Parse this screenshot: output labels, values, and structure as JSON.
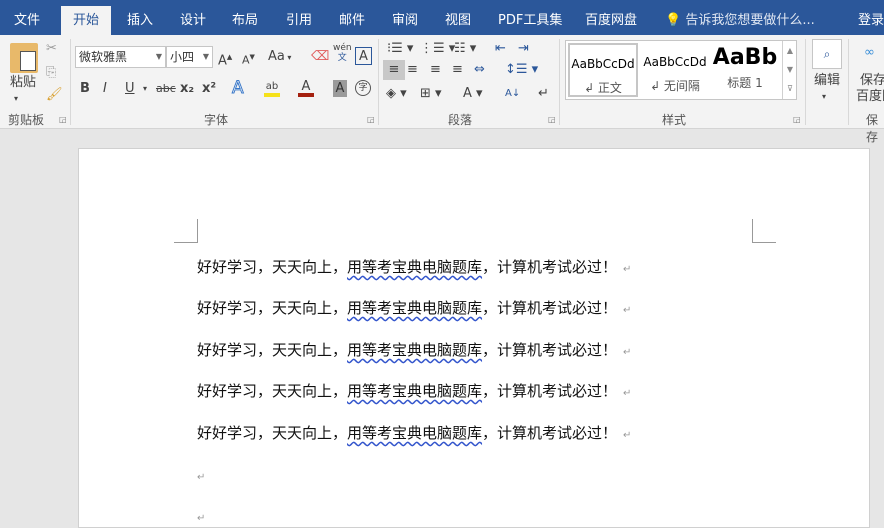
{
  "tabs": [
    "文件",
    "开始",
    "插入",
    "设计",
    "布局",
    "引用",
    "邮件",
    "审阅",
    "视图",
    "PDF工具集",
    "百度网盘"
  ],
  "active_tab": "开始",
  "tell_me": "告诉我您想要做什么...",
  "login": "登录",
  "clipboard": {
    "paste": "粘贴",
    "group": "剪贴板"
  },
  "font": {
    "name": "微软雅黑",
    "size": "小四",
    "group": "字体",
    "aa": "Aa",
    "bold": "B",
    "italic": "I",
    "underline": "U",
    "strike": "abc",
    "sub": "x₂",
    "sup": "x²",
    "wen": "wén",
    "wen2": "文",
    "char_border": "A",
    "enclose": "字"
  },
  "paragraph": {
    "group": "段落"
  },
  "styles": {
    "group": "样式",
    "items": [
      {
        "preview": "AaBbCcDd",
        "name": "↲ 正文"
      },
      {
        "preview": "AaBbCcDd",
        "name": "↲ 无间隔"
      },
      {
        "preview": "AaBb",
        "name": "标题 1"
      }
    ]
  },
  "editing": {
    "label": "编辑"
  },
  "save": {
    "label1": "保存到",
    "label2": "百度网盘",
    "group": "保存"
  },
  "document": {
    "lines": [
      {
        "a": "好好学习，天天向上，",
        "b": "用等考宝典电脑题库",
        "c": "，计算机考试必过！"
      },
      {
        "a": "好好学习，天天向上，",
        "b": "用等考宝典电脑题库",
        "c": "，计算机考试必过！"
      },
      {
        "a": "好好学习，天天向上，",
        "b": "用等考宝典电脑题库",
        "c": "，计算机考试必过！"
      },
      {
        "a": "好好学习，天天向上，",
        "b": "用等考宝典电脑题库",
        "c": "，计算机考试必过！"
      },
      {
        "a": "好好学习，天天向上，",
        "b": "用等考宝典电脑题库",
        "c": "，计算机考试必过！"
      }
    ],
    "para_mark": "↵"
  }
}
